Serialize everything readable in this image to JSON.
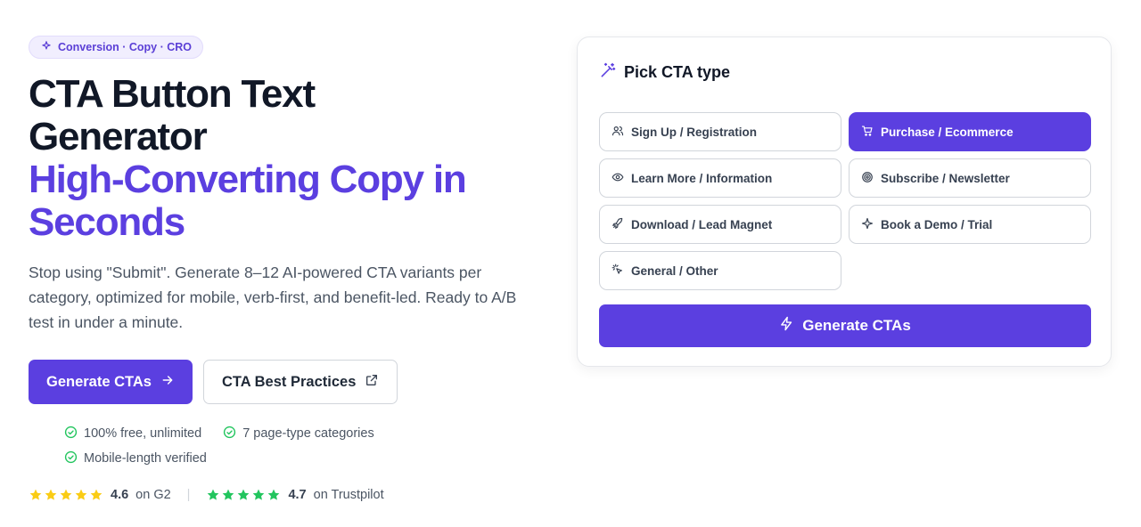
{
  "hero": {
    "badge": "Conversion · Copy · CRO",
    "title_line1": "CTA Button Text",
    "title_line2": "Generator",
    "title_accent_line1": "High-Converting Copy in",
    "title_accent_line2": "Seconds",
    "subtitle": "Stop using \"Submit\". Generate 8–12 AI-powered CTA variants per category, optimized for mobile, verb-first, and benefit-led. Ready to A/B test in under a minute.",
    "primary_button": "Generate CTAs",
    "secondary_button": "CTA Best Practices",
    "checks": [
      "100% free, unlimited",
      "7 page-type categories",
      "Mobile-length verified"
    ],
    "ratings": [
      {
        "score": "4.6",
        "source": "on G2",
        "star_color": "#facc15"
      },
      {
        "score": "4.7",
        "source": "on Trustpilot",
        "star_color": "#22c55e"
      }
    ]
  },
  "panel": {
    "title": "Pick CTA type",
    "options": [
      {
        "label": "Sign Up / Registration",
        "icon": "users-icon",
        "selected": false
      },
      {
        "label": "Purchase / Ecommerce",
        "icon": "cart-icon",
        "selected": true
      },
      {
        "label": "Learn More / Information",
        "icon": "eye-icon",
        "selected": false
      },
      {
        "label": "Subscribe / Newsletter",
        "icon": "target-icon",
        "selected": false
      },
      {
        "label": "Download / Lead Magnet",
        "icon": "rocket-icon",
        "selected": false
      },
      {
        "label": "Book a Demo / Trial",
        "icon": "sparkle-icon",
        "selected": false
      },
      {
        "label": "General / Other",
        "icon": "click-icon",
        "selected": false
      }
    ],
    "generate_button": "Generate CTAs"
  },
  "colors": {
    "accent": "#5b3fe0",
    "check_green": "#22c55e",
    "star_yellow": "#facc15"
  }
}
